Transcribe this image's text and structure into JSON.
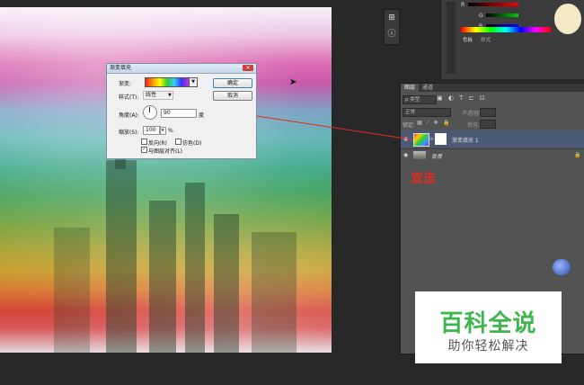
{
  "dialog": {
    "title": "渐变填充",
    "close": "×",
    "gradient_label": "渐变:",
    "style_label": "样式(T):",
    "style_value": "线性",
    "angle_label": "角度(A):",
    "angle_value": "90",
    "angle_unit": "度",
    "scale_label": "缩放(S):",
    "scale_value": "100",
    "scale_unit": "%",
    "reverse_label": "反向(R)",
    "dither_label": "仿色(D)",
    "align_label": "与图层对齐(L)",
    "ok_label": "确定",
    "cancel_label": "取消",
    "reverse_checked": false,
    "dither_checked": false,
    "align_checked": true
  },
  "layers_panel": {
    "tabs": [
      "图层",
      "通道"
    ],
    "kind_label": "ρ 类型",
    "blend_mode": "正常",
    "opacity_label": "不透明度:",
    "lock_label": "锁定:",
    "fill_label": "填充:",
    "layers": [
      {
        "name": "渐变填充 1",
        "selected": true
      },
      {
        "name": "背景",
        "selected": false
      }
    ]
  },
  "color_panel": {
    "tabs": [
      "色板",
      "样式"
    ],
    "r_label": "R",
    "g_label": "G",
    "b_label": "B"
  },
  "annotation": {
    "double_click": "双击"
  },
  "watermark": {
    "title": "百科全说",
    "subtitle": "助你轻松解决"
  },
  "colors": {
    "annotation_red": "#e8281e",
    "logo_green": "#3db64e",
    "selected_row": "#4b5a74"
  }
}
